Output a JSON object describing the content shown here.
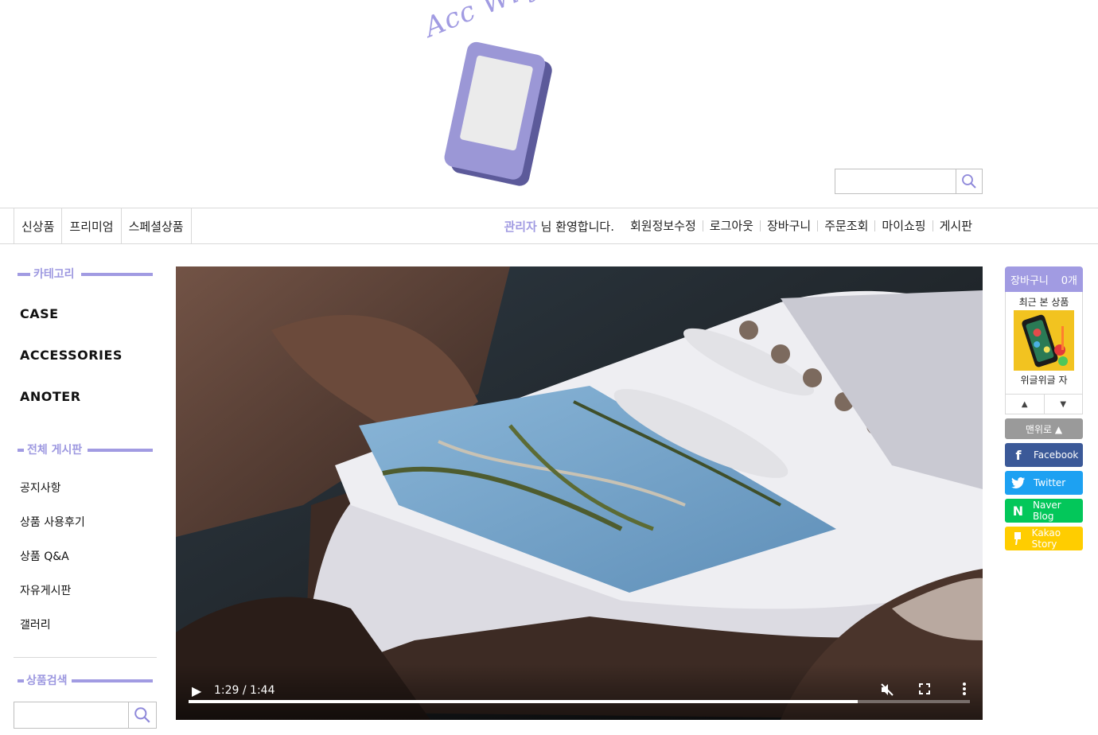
{
  "logo": {
    "text": "Acc Witj You"
  },
  "header": {
    "search_placeholder": ""
  },
  "nav": {
    "categories": [
      "신상품",
      "프리미엄",
      "스페셜상품"
    ],
    "welcome_name": "관리자",
    "welcome_suffix": " 님 환영합니다.",
    "links": [
      "회원정보수정",
      "로그아웃",
      "장바구니",
      "주문조회",
      "마이쇼핑",
      "게시판"
    ]
  },
  "sidebar": {
    "category_title": "카테고리",
    "categories": [
      "CASE",
      "ACCESSORIES",
      "ANOTER"
    ],
    "board_title": "전체 게시판",
    "boards": [
      "공지사항",
      "상품 사용후기",
      "상품 Q&A",
      "자유게시판",
      "갤러리"
    ],
    "search_title": "상품검색",
    "search_placeholder": ""
  },
  "video": {
    "time": "1:29 / 1:44",
    "progress": 0.856
  },
  "quick": {
    "cart_label": "장바구니",
    "cart_count": "0개",
    "recent_title": "최근 본 상품",
    "recent_item": "위글위글 자",
    "top_label": "맨위로 ▲",
    "shares": [
      {
        "label": "Facebook",
        "icon": "f",
        "color": "#3b5998"
      },
      {
        "label": "Twitter",
        "icon": "t",
        "color": "#1da1f2"
      },
      {
        "label": "Naver Blog",
        "icon": "N",
        "color": "#03c75a"
      },
      {
        "label": "Kakao Story",
        "icon": "k",
        "color": "#ffcd00"
      }
    ]
  },
  "colors": {
    "accent": "#a19be2",
    "phone_body": "#9b97d6",
    "phone_side": "#5c5a9a"
  }
}
